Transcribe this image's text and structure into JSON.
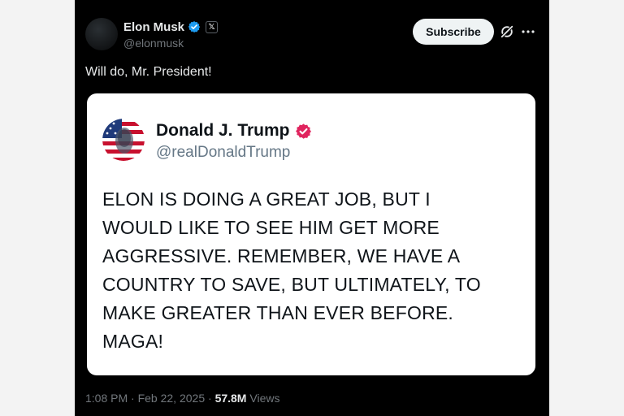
{
  "author": {
    "name": "Elon Musk",
    "handle": "@elonmusk",
    "affiliate_badge": "𝕏"
  },
  "subscribe_label": "Subscribe",
  "tweet_text": "Will do, Mr. President!",
  "quoted": {
    "name": "Donald J. Trump",
    "handle": "@realDonaldTrump",
    "lines": [
      "ELON IS DOING A GREAT JOB, BUT I",
      "WOULD LIKE TO SEE HIM GET MORE",
      "AGGRESSIVE. REMEMBER, WE HAVE A",
      "COUNTRY TO SAVE, BUT ULTIMATELY, TO",
      "MAKE GREATER THAN EVER BEFORE.",
      "MAGA!"
    ]
  },
  "meta": {
    "time": "1:08 PM",
    "separator": " · ",
    "date": "Feb 22, 2025",
    "views_count": "57.8M",
    "views_label": " Views"
  },
  "icons": {
    "verified_blue": "verified-badge-icon",
    "verified_pink": "verified-badge-icon",
    "grok": "grok-icon",
    "more": "more-icon"
  },
  "colors": {
    "background": "#000000",
    "card": "#ffffff",
    "verified_blue": "#1d9bf0",
    "verified_pink": "#e0245e",
    "muted": "#71767b"
  }
}
